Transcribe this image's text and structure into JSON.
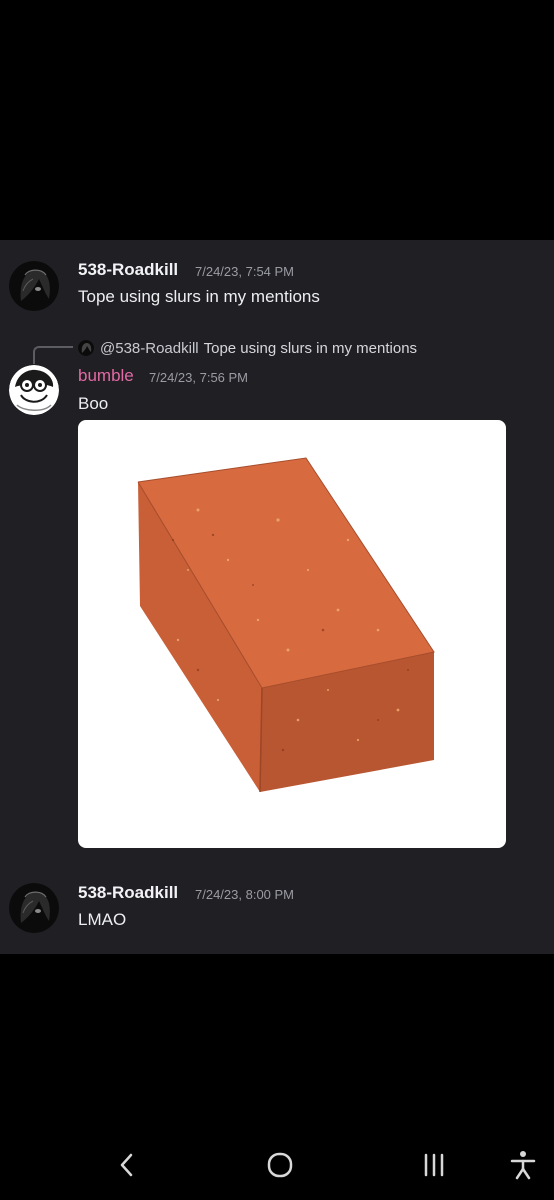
{
  "messages": [
    {
      "author": "538-Roadkill",
      "timestamp": "7/24/23, 7:54 PM",
      "text": "Tope using slurs in my mentions",
      "avatar_icon": "dark-character-avatar-icon"
    },
    {
      "author": "bumble",
      "author_color": "#e26aa5",
      "timestamp": "7/24/23, 7:56 PM",
      "text": "Boo",
      "avatar_icon": "cartoon-character-avatar-icon",
      "reply_to": {
        "user": "@538-Roadkill",
        "text": "Tope using slurs in my mentions"
      },
      "attachment": {
        "type": "image",
        "subject_icon": "brick-icon"
      }
    },
    {
      "author": "538-Roadkill",
      "timestamp": "7/24/23, 8:00 PM",
      "text": "LMAO",
      "avatar_icon": "dark-character-avatar-icon"
    }
  ],
  "navbar": {
    "buttons": [
      "back-icon",
      "home-icon",
      "recent-apps-icon",
      "accessibility-icon"
    ]
  },
  "colors": {
    "chat_background": "#1f1f24",
    "outer_background": "#000000",
    "username": "#f2f3f5",
    "timestamp": "#9b9ca3",
    "brick": "#c8623a"
  }
}
